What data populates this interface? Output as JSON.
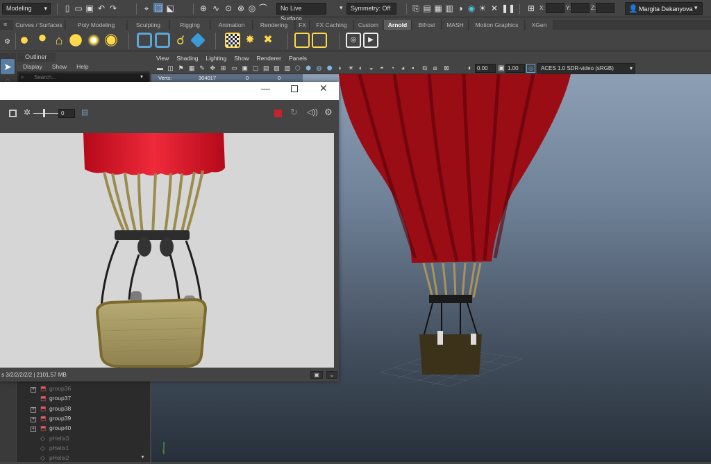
{
  "status_line": {
    "menu_set": "Modeling",
    "live_surface": "No Live Surface",
    "symmetry": "Symmetry: Off",
    "x_label": "X:",
    "y_label": "Y:",
    "z_label": "Z:",
    "user": "Margita Dekanyova"
  },
  "shelf": {
    "tabs": [
      "Curves / Surfaces",
      "Poly Modeling",
      "Sculpting",
      "Rigging",
      "Animation",
      "Rendering",
      "FX",
      "FX Caching",
      "Custom",
      "Arnold",
      "Bifrost",
      "MASH",
      "Motion Graphics",
      "XGen"
    ],
    "active_tab": "Arnold"
  },
  "outliner": {
    "tab": "Outliner",
    "menu": [
      "Display",
      "Show",
      "Help"
    ],
    "search_placeholder": "Search...",
    "items": [
      {
        "label": "group36",
        "type": "group",
        "expand": "+",
        "dim": true
      },
      {
        "label": "group37",
        "type": "group",
        "expand": "",
        "dim": false
      },
      {
        "label": "group38",
        "type": "group",
        "expand": "+",
        "dim": false
      },
      {
        "label": "group39",
        "type": "group",
        "expand": "+",
        "dim": false
      },
      {
        "label": "group40",
        "type": "group",
        "expand": "+",
        "dim": false
      },
      {
        "label": "pHelix3",
        "type": "helix",
        "expand": "",
        "dim": true
      },
      {
        "label": "pHelix1",
        "type": "helix",
        "expand": "",
        "dim": true
      },
      {
        "label": "pHelix2",
        "type": "helix",
        "expand": "",
        "dim": true
      }
    ]
  },
  "viewport": {
    "menu": [
      "View",
      "Shading",
      "Lighting",
      "Show",
      "Renderer",
      "Panels"
    ],
    "exposure": "0.00",
    "gamma": "1.00",
    "color_space": "ACES 1.0 SDR-video (sRGB)",
    "hud": {
      "label": "Verts:",
      "v1": "304017",
      "v2": "0",
      "v3": "0"
    }
  },
  "render_view": {
    "exposure_value": "0",
    "status": "s 3/2/2/2/2/2 | 2101.57 MB"
  },
  "colors": {
    "balloon_red": "#c8101e",
    "dark_red": "#7a0010",
    "basket": "#a89a5c",
    "arnold_accent": "#6fa0c8"
  }
}
